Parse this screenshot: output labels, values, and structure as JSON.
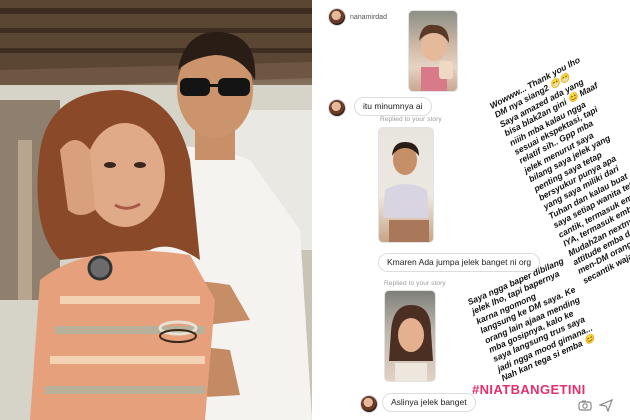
{
  "story": {
    "username": "nanamirdad",
    "messages": [
      {
        "id": "m1",
        "text": "itu minumnya ai"
      },
      {
        "id": "m2",
        "text": "Kmaren Ada jumpa jelek banget ni org"
      },
      {
        "id": "m3",
        "text": "Aslinya jelek banget"
      }
    ],
    "replied_label_1": "Replied to your story",
    "replied_label_2": "Replied to your story",
    "caption_1": "Wowww... Thank you lho\nDM nya siang2 😁😁\nSaya amazed ada yang\nbisa blak2an gini 😊 Maaf\nniiih mba kalau ngga\nsesuai ekspektasi, tapi\nrelatif sih.. Gpp mba\njelek menurut saya\nbilang saya jelek yang\npenting saya tetap\nbersyukur punya apa\nyang saya miliki dari\nTuhan dan kalau buat\nsaya setiap wanita tetap\ncantik, termasuk emba.\nIYA, termasuk emba.\nMudah2an nextnya\nattitude emba dalam\nmen-DM orang bisa\nsecantik wajahnya 😊",
    "caption_2": "Saya ngga baper dibilang\njelek lho, tapi bapernya\nkarna ngomong\nlangsung ke DM saya. Ke\norang lain ajaaa mending\nmba gosipnya, kalo ke\nsaya langsung trus saya\njadi ngga mood gimana...\nNah kan tega si emba 😊",
    "hashtag": "#NIATBANGETINI"
  },
  "colors": {
    "hashtag": "#e1306c",
    "bubble_border": "#dcdcdc",
    "text": "#222222"
  },
  "icons": {
    "camera": "camera-icon",
    "reply_arrow": "reply-icon",
    "send": "send-icon"
  }
}
